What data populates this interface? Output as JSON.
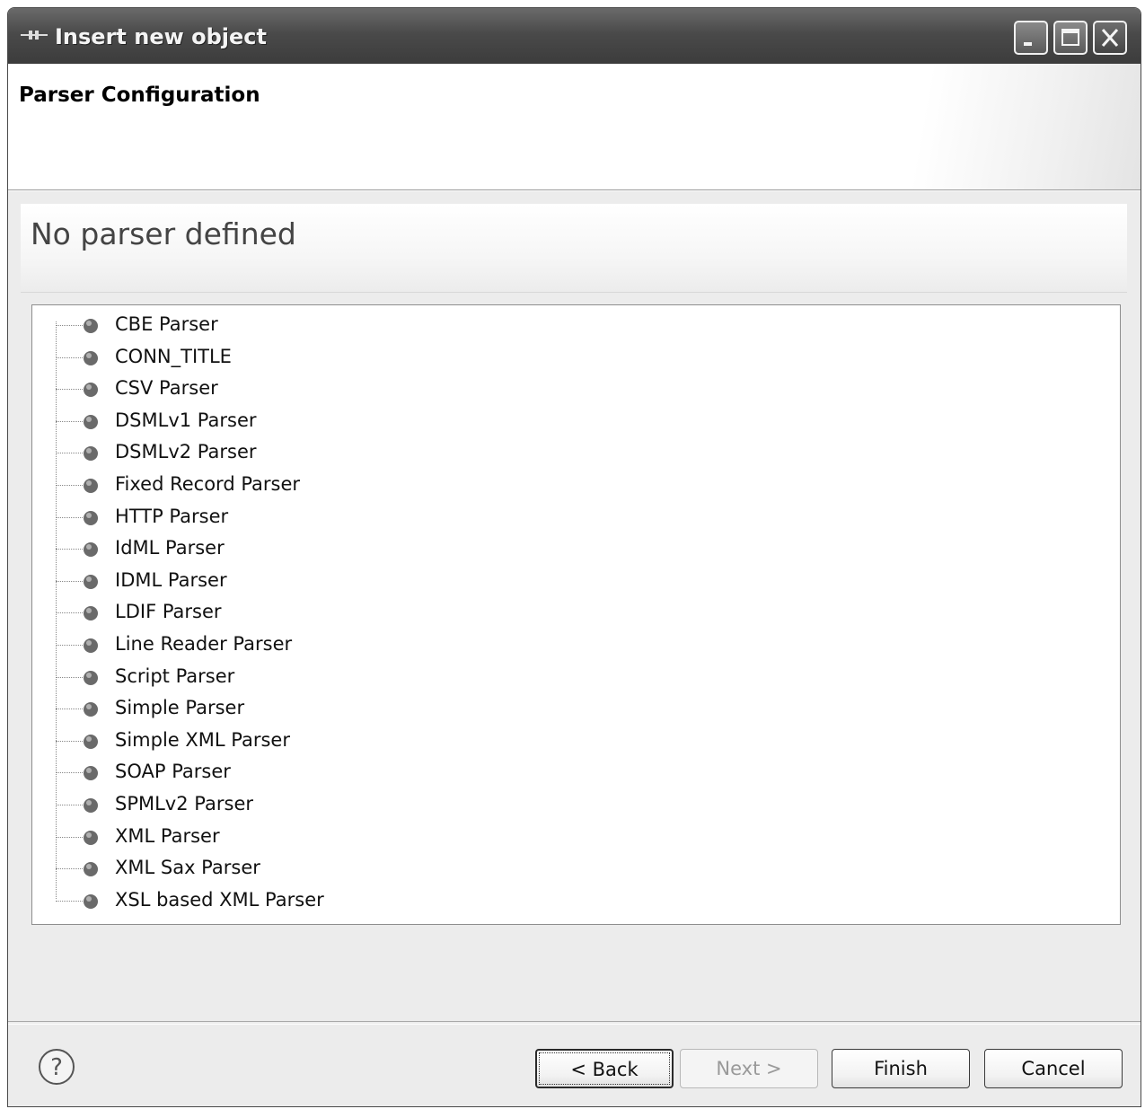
{
  "window": {
    "title": "Insert new object"
  },
  "header": {
    "title": "Parser Configuration"
  },
  "form": {
    "heading": "No parser defined"
  },
  "tree": {
    "items": [
      {
        "label": "CBE Parser"
      },
      {
        "label": "CONN_TITLE"
      },
      {
        "label": "CSV Parser"
      },
      {
        "label": "DSMLv1 Parser"
      },
      {
        "label": "DSMLv2 Parser"
      },
      {
        "label": "Fixed Record Parser"
      },
      {
        "label": "HTTP Parser"
      },
      {
        "label": "IdML Parser"
      },
      {
        "label": "IDML Parser"
      },
      {
        "label": "LDIF Parser"
      },
      {
        "label": "Line Reader Parser"
      },
      {
        "label": "Script Parser"
      },
      {
        "label": "Simple Parser"
      },
      {
        "label": "Simple XML Parser"
      },
      {
        "label": "SOAP Parser"
      },
      {
        "label": "SPMLv2 Parser"
      },
      {
        "label": "XML Parser"
      },
      {
        "label": "XML Sax Parser"
      },
      {
        "label": "XSL based XML Parser"
      }
    ]
  },
  "footer": {
    "help_icon": "question-mark-circle",
    "back_label": "< Back",
    "next_label": "Next >",
    "finish_label": "Finish",
    "cancel_label": "Cancel",
    "next_enabled": false
  },
  "colors": {
    "titlebar": "#4a4a4a",
    "dialog_bg": "#ececec",
    "tree_bg": "#ffffff",
    "bullet": "#6a6a6a"
  }
}
